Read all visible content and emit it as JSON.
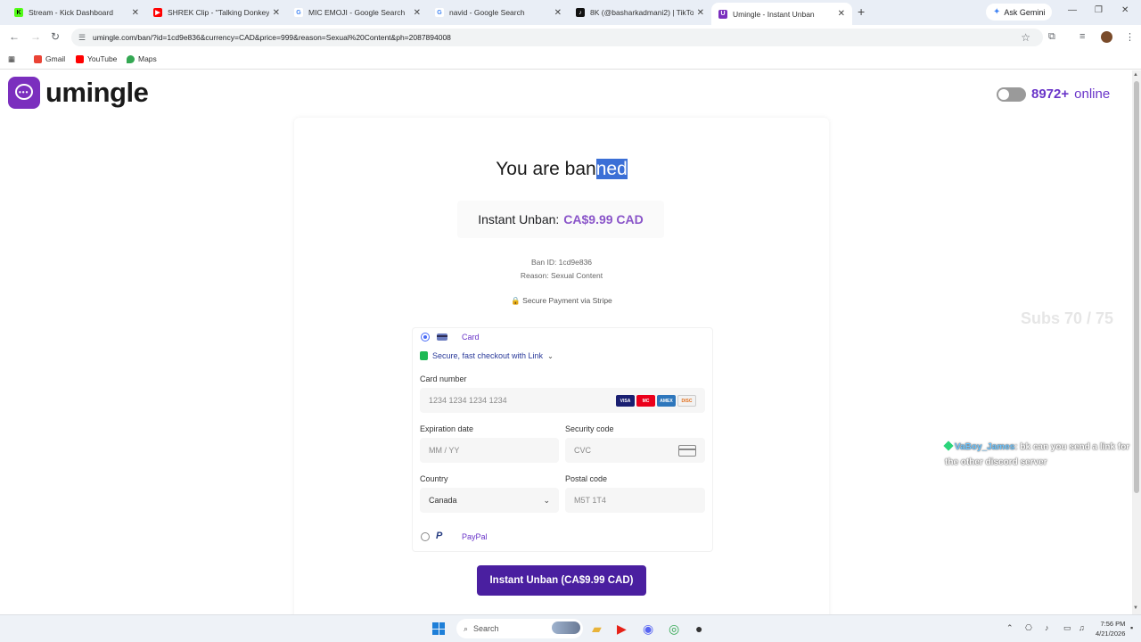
{
  "browser": {
    "tabs": [
      {
        "label": "Stream - Kick Dashboard",
        "favicon_color": "#53fc18",
        "favicon_char": "K"
      },
      {
        "label": "SHREK Clip - \"Talking Donkey\"",
        "favicon_color": "#ff0000",
        "favicon_char": "▶"
      },
      {
        "label": "MIC EMOJI - Google Search",
        "favicon_color": "#4285f4",
        "favicon_char": "G"
      },
      {
        "label": "navid - Google Search",
        "favicon_color": "#4285f4",
        "favicon_char": "G"
      },
      {
        "label": "8K (@basharkadmani2) | TikTok",
        "favicon_color": "#111111",
        "favicon_char": "♪"
      },
      {
        "label": "Umingle - Instant Unban",
        "favicon_color": "#7b2fbe",
        "favicon_char": "U"
      }
    ],
    "new_tab": "+",
    "ask_gemini": "Ask Gemini",
    "url": "umingle.com/ban/?id=1cd9e836&currency=CAD&price=999&reason=Sexual%20Content&ph=2087894008",
    "bookmarks": [
      {
        "label": "Gmail",
        "color": "#ea4335"
      },
      {
        "label": "YouTube",
        "color": "#ff0000"
      },
      {
        "label": "Maps",
        "color": "#34a853"
      }
    ]
  },
  "header": {
    "brand": "umingle",
    "online_count": "8972+",
    "online_label": "online"
  },
  "ban": {
    "title_before": "You are ban",
    "title_highlight": "ned",
    "price_label": "Instant Unban:",
    "price_value": "CA$9.99 CAD",
    "ban_id": "Ban ID: 1cd9e836",
    "reason": "Reason: Sexual Content",
    "secure_text": "Secure Payment via Stripe"
  },
  "payment": {
    "card_label": "Card",
    "link_text": "Secure, fast checkout with Link",
    "card_number_label": "Card number",
    "card_number_placeholder": "1234 1234 1234 1234",
    "card_brands": [
      "VISA",
      "MC",
      "AMEX",
      "DISC"
    ],
    "expiration_label": "Expiration date",
    "expiration_placeholder": "MM / YY",
    "security_label": "Security code",
    "security_placeholder": "CVC",
    "country_label": "Country",
    "country_value": "Canada",
    "postal_label": "Postal code",
    "postal_placeholder": "M5T 1T4",
    "paypal_label": "PayPal",
    "submit_label": "Instant Unban (CA$9.99 CAD)"
  },
  "stream_overlay": {
    "subs": "Subs 70 / 75",
    "chat_user": "VaBoy_James",
    "chat_message": ": bk can you send a link for the other discord server"
  },
  "taskbar": {
    "search_placeholder": "Search",
    "time": "7:56 PM",
    "date": "4/21/2026"
  }
}
